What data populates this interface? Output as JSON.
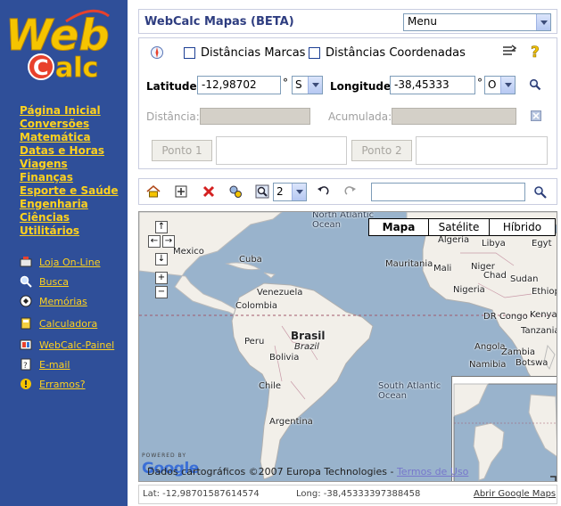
{
  "logo": {
    "line1": "Web",
    "line2": "alc",
    "letter": "C"
  },
  "sidebar": {
    "nav": [
      "Página Inicial",
      "Conversões",
      "Matemática",
      "Datas e Horas",
      "Viagens",
      "Finanças",
      "Esporte e Saúde",
      "Engenharia",
      "Ciências",
      "Utilitários"
    ],
    "tools": [
      {
        "label": "Loja On-Line",
        "icon": "shop-icon"
      },
      {
        "label": "Busca",
        "icon": "search-icon"
      },
      {
        "label": "Memórias",
        "icon": "memory-icon"
      },
      {
        "label": "Calculadora",
        "icon": "calculator-icon"
      },
      {
        "label": "WebCalc-Painel",
        "icon": "panel-icon"
      },
      {
        "label": "E-mail",
        "icon": "email-icon"
      },
      {
        "label": "Erramos?",
        "icon": "warning-icon"
      }
    ]
  },
  "header": {
    "title": "WebCalc Mapas  (BETA)",
    "menu_value": "Menu"
  },
  "controls": {
    "chk_markers": "Distâncias Marcas",
    "chk_coords": "Distâncias Coordenadas",
    "lat_label": "Latitude:",
    "lat_value": "-12,98702",
    "lat_dir": "S",
    "lon_label": "Longitude:",
    "lon_value": "-38,45333",
    "lon_dir": "O",
    "degree": "°",
    "dist_label": "Distância:",
    "acc_label": "Acumulada:",
    "point1": "Ponto 1",
    "point2": "Ponto 2"
  },
  "toolbar": {
    "zoom_value": "2",
    "search_value": ""
  },
  "map": {
    "types": [
      "Mapa",
      "Satélite",
      "Híbrido"
    ],
    "labels": {
      "north_atlantic": "North Atlantic\nOcean",
      "mexico": "Mexico",
      "cuba": "Cuba",
      "venezuela": "Venezuela",
      "colombia": "Colombia",
      "peru": "Peru",
      "brasil": "Brasil",
      "brazil": "Brazil",
      "bolivia": "Bolivia",
      "chile": "Chile",
      "argentina": "Argentina",
      "south_atlantic": "South Atlantic\nOcean",
      "algeria": "Algeria",
      "libya": "Libya",
      "egypt": "Egyt",
      "mauritania": "Mauritania",
      "mali": "Mali",
      "niger": "Niger",
      "chad": "Chad",
      "sudan": "Sudan",
      "nigeria": "Nigeria",
      "ethiopia": "Ethiopi",
      "dr_congo": "DR Congo",
      "kenya": "Kenya",
      "tanzania": "Tanzania",
      "angola": "Angola",
      "zambia": "Zambia",
      "namibia": "Namibia",
      "botswana": "Botswa"
    },
    "powered_by": "POWERED BY",
    "google": "Google",
    "copyright": "Dados cartográficos ©2007 Europa Technologies - ",
    "terms": "Termos de Uso"
  },
  "status": {
    "lat": "Lat: -12,98701587614574",
    "lon": "Long: -38,45333397388458",
    "open_link": "Abrir Google Maps"
  }
}
